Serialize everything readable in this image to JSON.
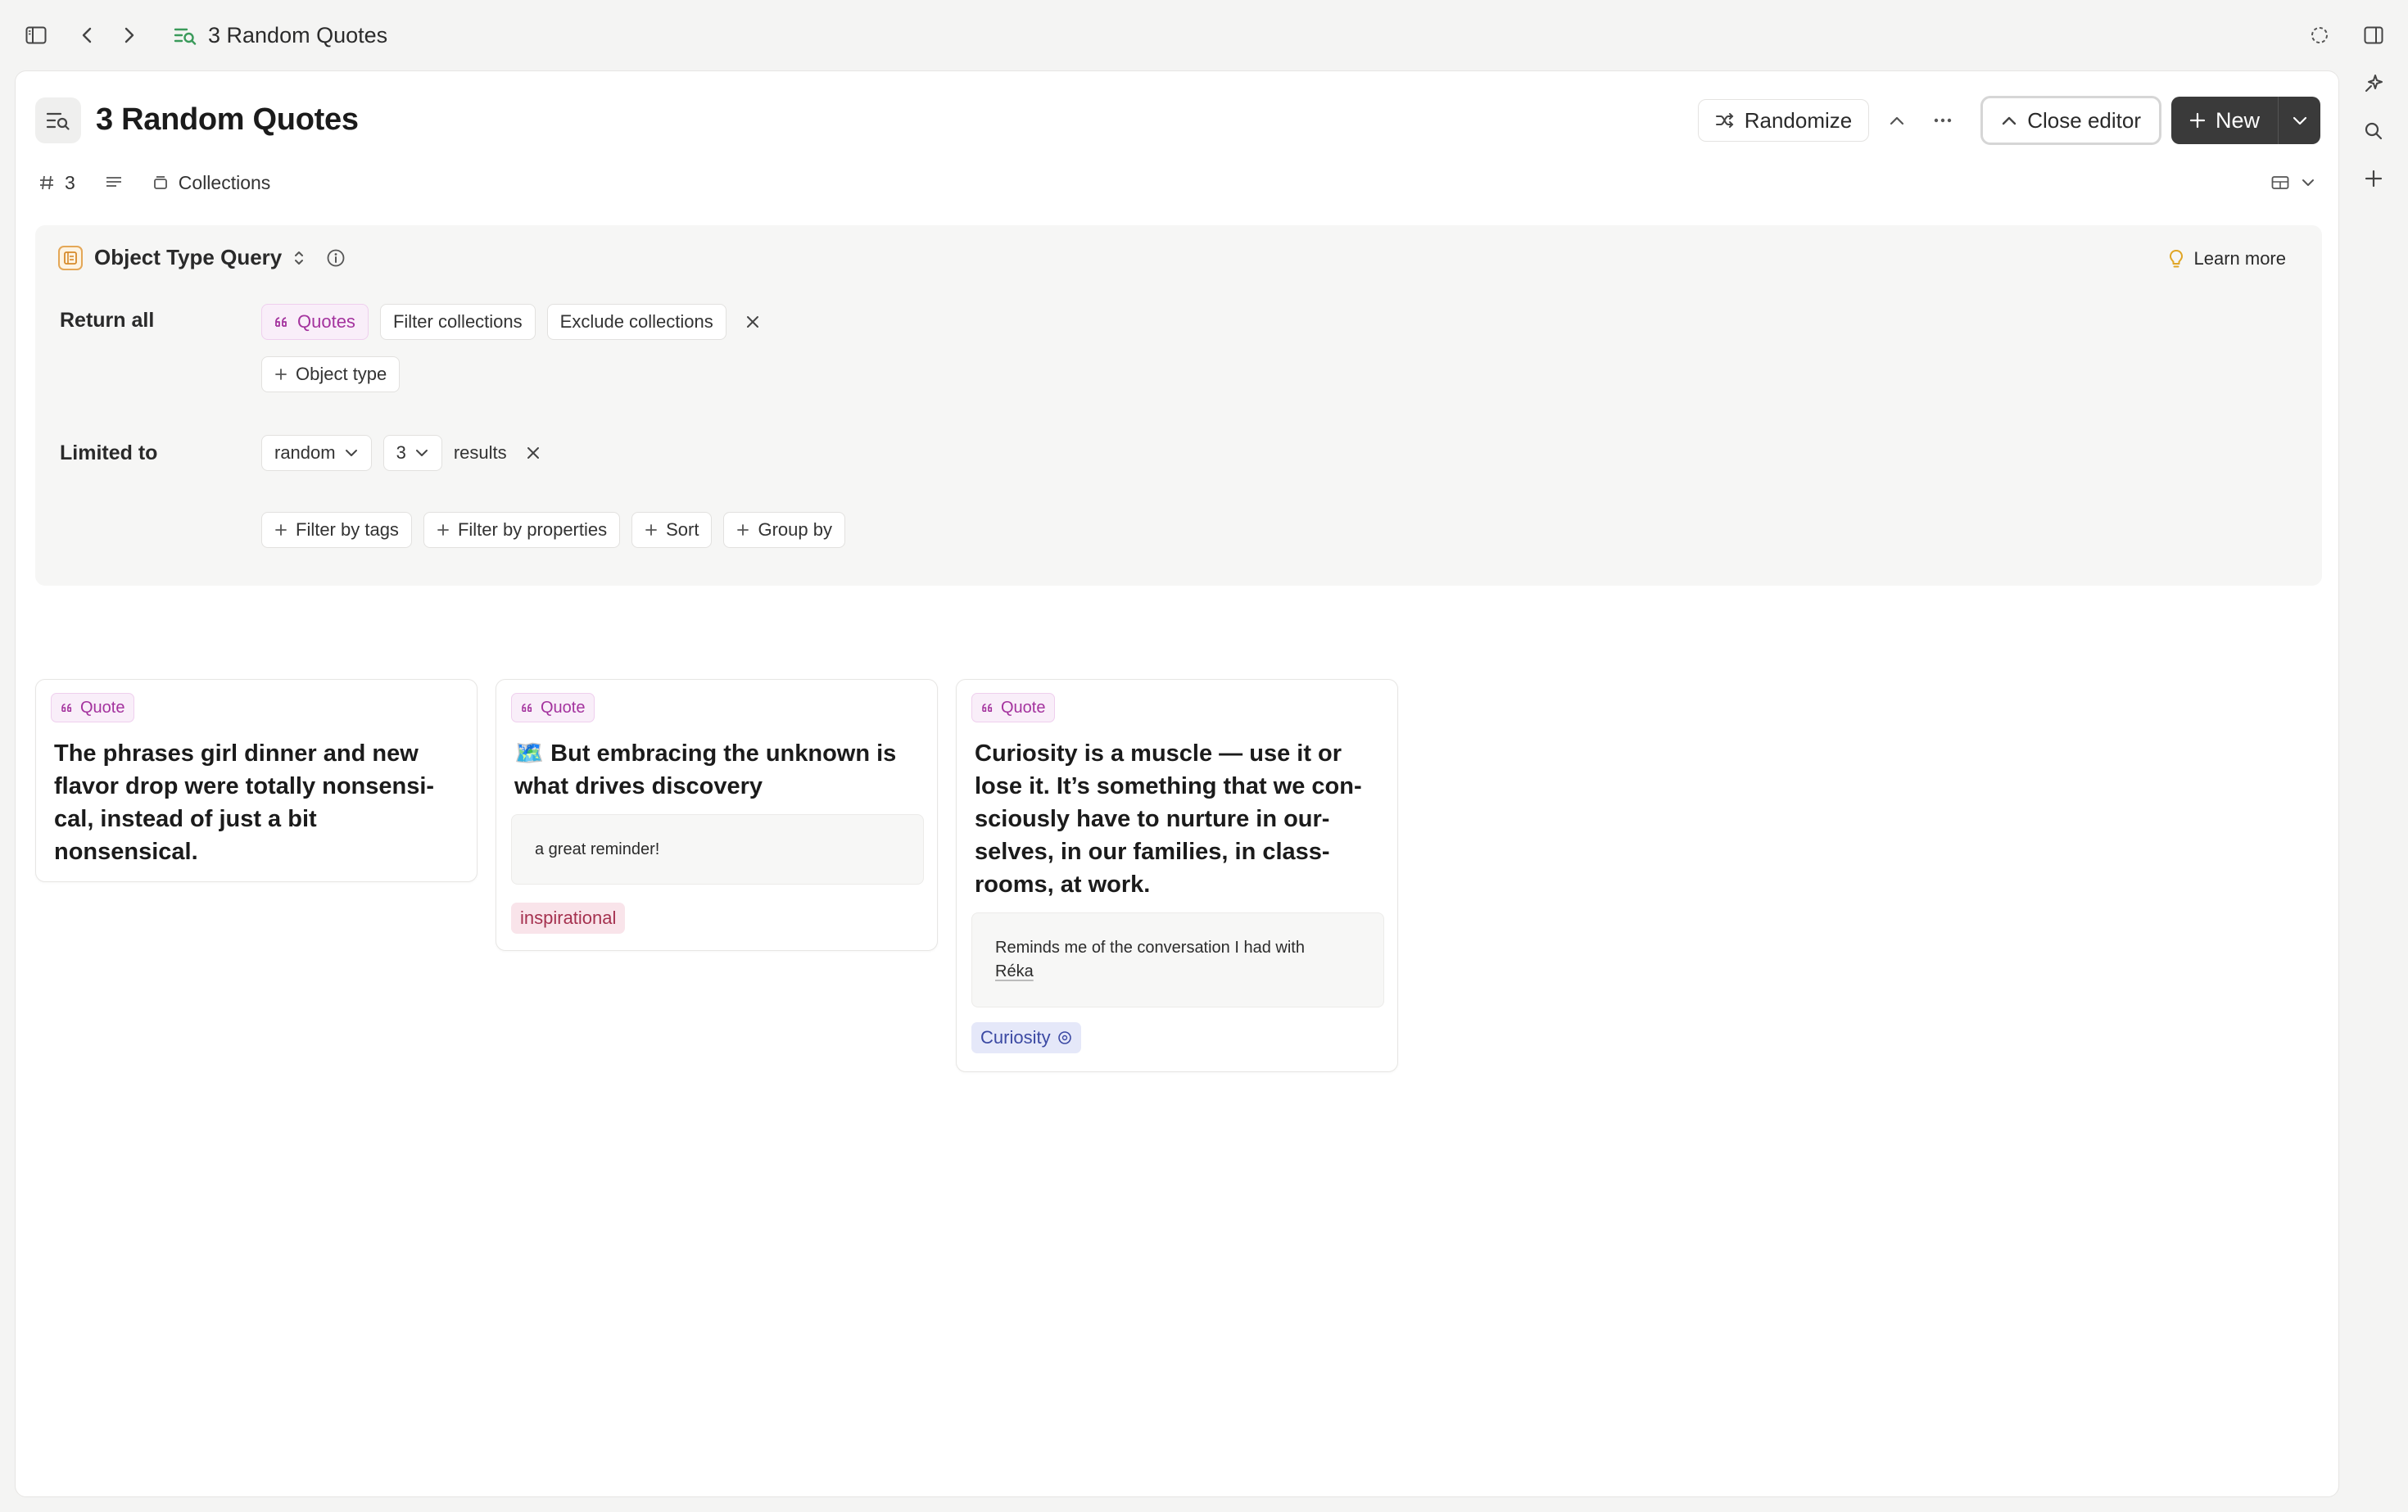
{
  "window": {
    "title": "3 Random Quotes"
  },
  "header": {
    "title": "3 Random Quotes",
    "randomize_label": "Randomize",
    "close_editor_label": "Close editor",
    "new_label": "New"
  },
  "subbar": {
    "count": "3",
    "collections_label": "Collections"
  },
  "editor": {
    "query_type": "Object Type Query",
    "learn_more": "Learn more",
    "return_all_label": "Return all",
    "chips": {
      "quotes": "Quotes",
      "filter_collections": "Filter collections",
      "exclude_collections": "Exclude collections",
      "object_type": "Object type"
    },
    "limited_to_label": "Limited to",
    "limit_mode": "random",
    "limit_count": "3",
    "results_label": "results",
    "actions": {
      "filter_tags": "Filter by tags",
      "filter_properties": "Filter by properties",
      "sort": "Sort",
      "group_by": "Group by"
    }
  },
  "cards": [
    {
      "badge": "Quote",
      "text": "The phrases girl dinner and new flavor drop were totally nonsensi-cal, instead of just a bit nonsensical."
    },
    {
      "badge": "Quote",
      "emoji": "🗺️",
      "text": "But embracing the unknown is what drives discovery",
      "note": "a great reminder!",
      "tag": "inspirational"
    },
    {
      "badge": "Quote",
      "text": "Curiosity is a muscle — use it or lose it. It’s something that we con-sciously have to nurture in our-selves, in our families, in class-rooms, at work.",
      "note_prefix": "Reminds me of the conversation I had with",
      "note_link": "Réka",
      "tag": "Curiosity"
    }
  ],
  "colors": {
    "accent_quote": "#a4339e",
    "tag_inspirational": "#a5314f",
    "tag_curiosity": "#3b49a3",
    "new_button": "#3a3a3a"
  }
}
